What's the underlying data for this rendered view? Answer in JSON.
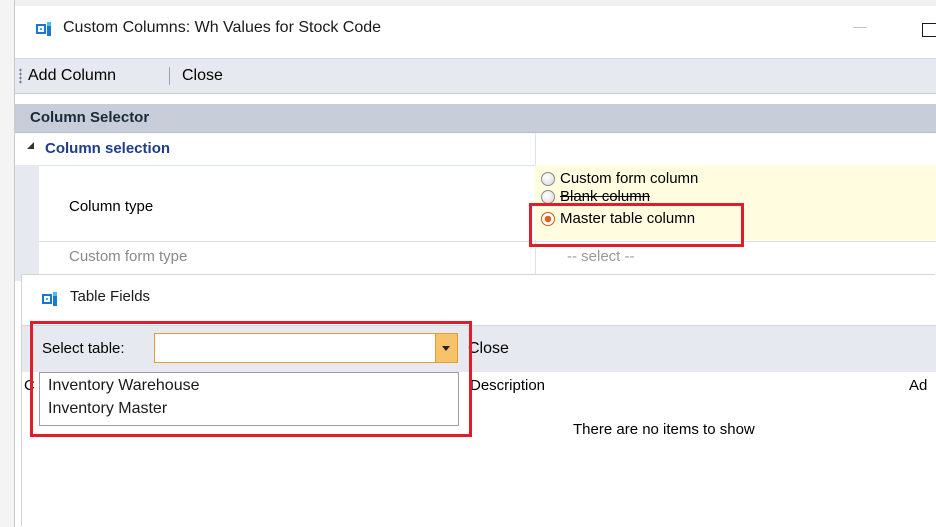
{
  "main_window": {
    "title": "Custom Columns: Wh Values for Stock Code",
    "minimize_glyph": "—"
  },
  "toolbar": {
    "add_column_label": "Add Column",
    "close_label": "Close"
  },
  "column_selector": {
    "header": "Column Selector",
    "group_label": "Column selection",
    "column_type_label": "Column type",
    "options": [
      {
        "label": "Custom form column",
        "checked": false
      },
      {
        "label": "Blank column",
        "checked": false
      },
      {
        "label": "Master table column",
        "checked": true
      }
    ],
    "custom_form_type_label": "Custom form type",
    "custom_form_type_value": "-- select --"
  },
  "table_fields": {
    "title": "Table Fields",
    "select_table_label": "Select table:",
    "select_table_value": "",
    "close_label": "Close",
    "columns": {
      "first_partial": "C",
      "description": "Description",
      "last_partial": "Ad"
    },
    "empty_message": "There are no items to show",
    "dropdown_options": [
      "Inventory Warehouse",
      "Inventory Master"
    ]
  },
  "colors": {
    "accent_blue": "#1976d2",
    "highlight_red": "#e11d2a",
    "selector_orange": "#e79a33",
    "value_cell_yellow": "#fffce0",
    "group_label_blue": "#1f3d8a"
  },
  "icons": {
    "app_icon": "app-logo-icon",
    "group_toggle": "collapse-triangle-icon",
    "dropdown_arrow": "chevron-down-icon"
  }
}
